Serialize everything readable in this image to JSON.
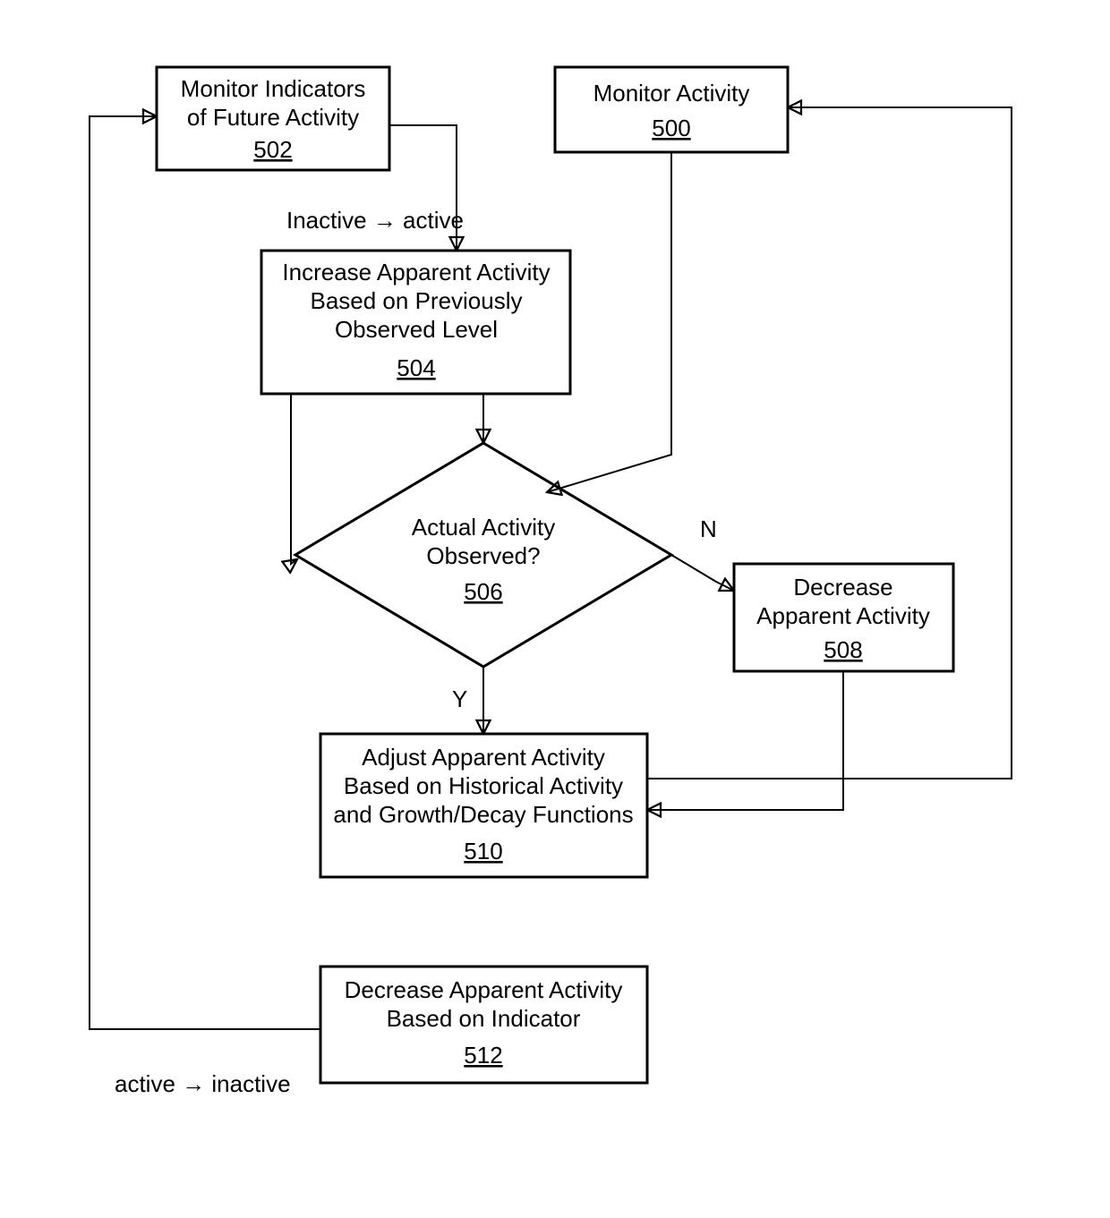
{
  "nodes": {
    "n502": {
      "lines": [
        "Monitor Indicators",
        "of Future Activity"
      ],
      "ref": "502"
    },
    "n500": {
      "lines": [
        "Monitor Activity"
      ],
      "ref": "500"
    },
    "n504": {
      "lines": [
        "Increase Apparent Activity",
        "Based on Previously",
        "Observed Level"
      ],
      "ref": "504"
    },
    "n506": {
      "lines": [
        "Actual Activity",
        "Observed?"
      ],
      "ref": "506"
    },
    "n508": {
      "lines": [
        "Decrease",
        "Apparent Activity"
      ],
      "ref": "508"
    },
    "n510": {
      "lines": [
        "Adjust Apparent Activity",
        "Based on Historical Activity",
        "and Growth/Decay Functions"
      ],
      "ref": "510"
    },
    "n512": {
      "lines": [
        "Decrease Apparent Activity",
        "Based on Indicator"
      ],
      "ref": "512"
    }
  },
  "edge_labels": {
    "inactive_to_active": "Inactive → active",
    "active_to_inactive": "active → inactive",
    "yes": "Y",
    "no": "N"
  }
}
